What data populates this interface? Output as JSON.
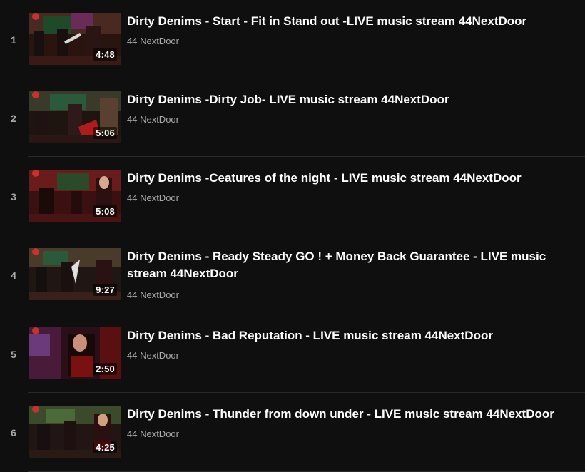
{
  "playlist": {
    "items": [
      {
        "index": "1",
        "title": "Dirty Denims - Start - Fit in Stand out -LIVE music stream 44NextDoor",
        "channel": "44 NextDoor",
        "duration": "4:48"
      },
      {
        "index": "2",
        "title": "Dirty Denims -Dirty Job- LIVE music stream 44NextDoor",
        "channel": "44 NextDoor",
        "duration": "5:06"
      },
      {
        "index": "3",
        "title": "Dirty Denims -Ceatures of the night - LIVE music stream 44NextDoor",
        "channel": "44 NextDoor",
        "duration": "5:08"
      },
      {
        "index": "4",
        "title": "Dirty Denims - Ready Steady GO ! + Money Back Guarantee - LIVE music stream 44NextDoor",
        "channel": "44 NextDoor",
        "duration": "9:27"
      },
      {
        "index": "5",
        "title": "Dirty Denims - Bad Reputation - LIVE music stream 44NextDoor",
        "channel": "44 NextDoor",
        "duration": "2:50"
      },
      {
        "index": "6",
        "title": "Dirty Denims - Thunder from down under - LIVE music stream 44NextDoor",
        "channel": "44 NextDoor",
        "duration": "4:25"
      }
    ]
  },
  "colors": {
    "background": "#0f0f0f",
    "title": "#ffffff",
    "secondary": "#aaaaaa",
    "divider": "#2a2a2a"
  }
}
